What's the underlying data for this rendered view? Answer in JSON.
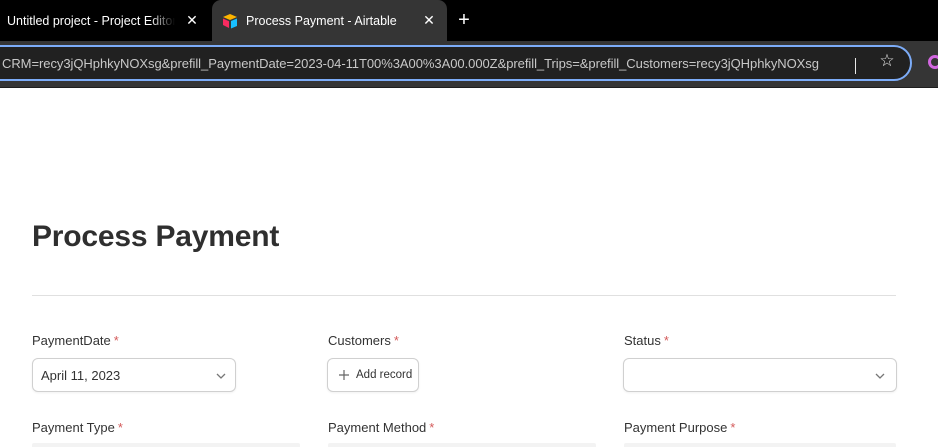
{
  "browser": {
    "tabs": [
      {
        "title": "Untitled project - Project Editor",
        "close": "✕",
        "active": false
      },
      {
        "title": "Process Payment - Airtable",
        "close": "✕",
        "active": true
      }
    ],
    "new_tab": "+",
    "url": "CRM=recy3jQHphkyNOXsg&prefill_PaymentDate=2023-04-11T00%3A00%3A00.000Z&prefill_Trips=&prefill_Customers=recy3jQHphkyNOXsg",
    "bookmark_star": "☆",
    "accent_color": "#7cacf8"
  },
  "form": {
    "title": "Process Payment",
    "required_marker": "*",
    "fields": {
      "payment_date": {
        "label": "PaymentDate",
        "value": "April 11, 2023"
      },
      "customers": {
        "label": "Customers",
        "add_label": "Add record"
      },
      "status": {
        "label": "Status",
        "value": ""
      },
      "payment_type": {
        "label": "Payment Type"
      },
      "payment_method": {
        "label": "Payment Method"
      },
      "payment_purpose": {
        "label": "Payment Purpose"
      }
    },
    "required_color": "#d45a5a"
  }
}
